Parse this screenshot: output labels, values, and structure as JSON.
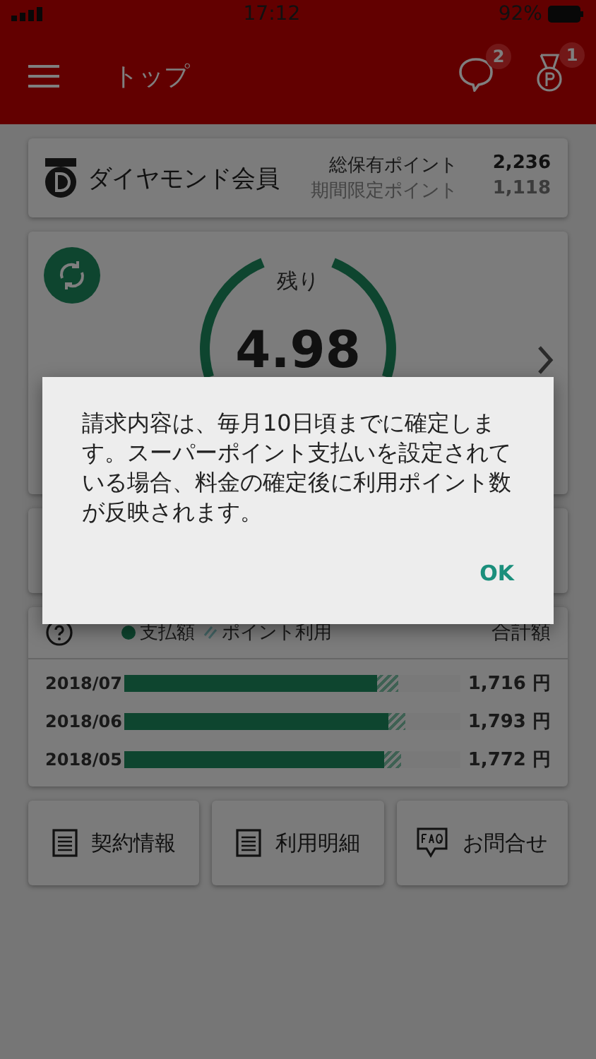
{
  "status_bar": {
    "time": "17:12",
    "battery": "92%"
  },
  "header": {
    "title": "トップ",
    "messages_badge": "2",
    "points_badge": "1"
  },
  "member": {
    "rank": "ダイヤモンド会員",
    "total_label": "総保有ポイント",
    "total_value": "2,236",
    "limited_label": "期間限定ポイント",
    "limited_value": "1,118"
  },
  "data_card": {
    "label": "残り",
    "value": "4.98"
  },
  "billing": {
    "legend": [
      {
        "kind": "solid",
        "label": "支払額"
      },
      {
        "kind": "hatch",
        "label": "ポイント利用"
      }
    ],
    "total_heading": "合計額",
    "rows": [
      {
        "month": "2018/07",
        "paid": {
          "level": 0.75
        },
        "total": {
          "level": 0.815
        },
        "amount": "1,716 円"
      },
      {
        "month": "2018/06",
        "paid": {
          "level": 0.785
        },
        "total": {
          "level": 0.835
        },
        "amount": "1,793 円"
      },
      {
        "month": "2018/05",
        "paid": {
          "level": 0.77
        },
        "total": {
          "level": 0.82
        },
        "amount": "1,772 円"
      }
    ]
  },
  "shortcuts": [
    {
      "kind": "document",
      "label": "契約情報"
    },
    {
      "kind": "document",
      "label": "利用明細"
    },
    {
      "kind": "faq",
      "label": "お問合せ"
    }
  ],
  "dialog": {
    "message": "請求内容は、毎月10日頃までに確定します。スーパーポイント支払いを設定されている場合、料金の確定後に利用ポイント数が反映されます。",
    "button": "OK"
  }
}
